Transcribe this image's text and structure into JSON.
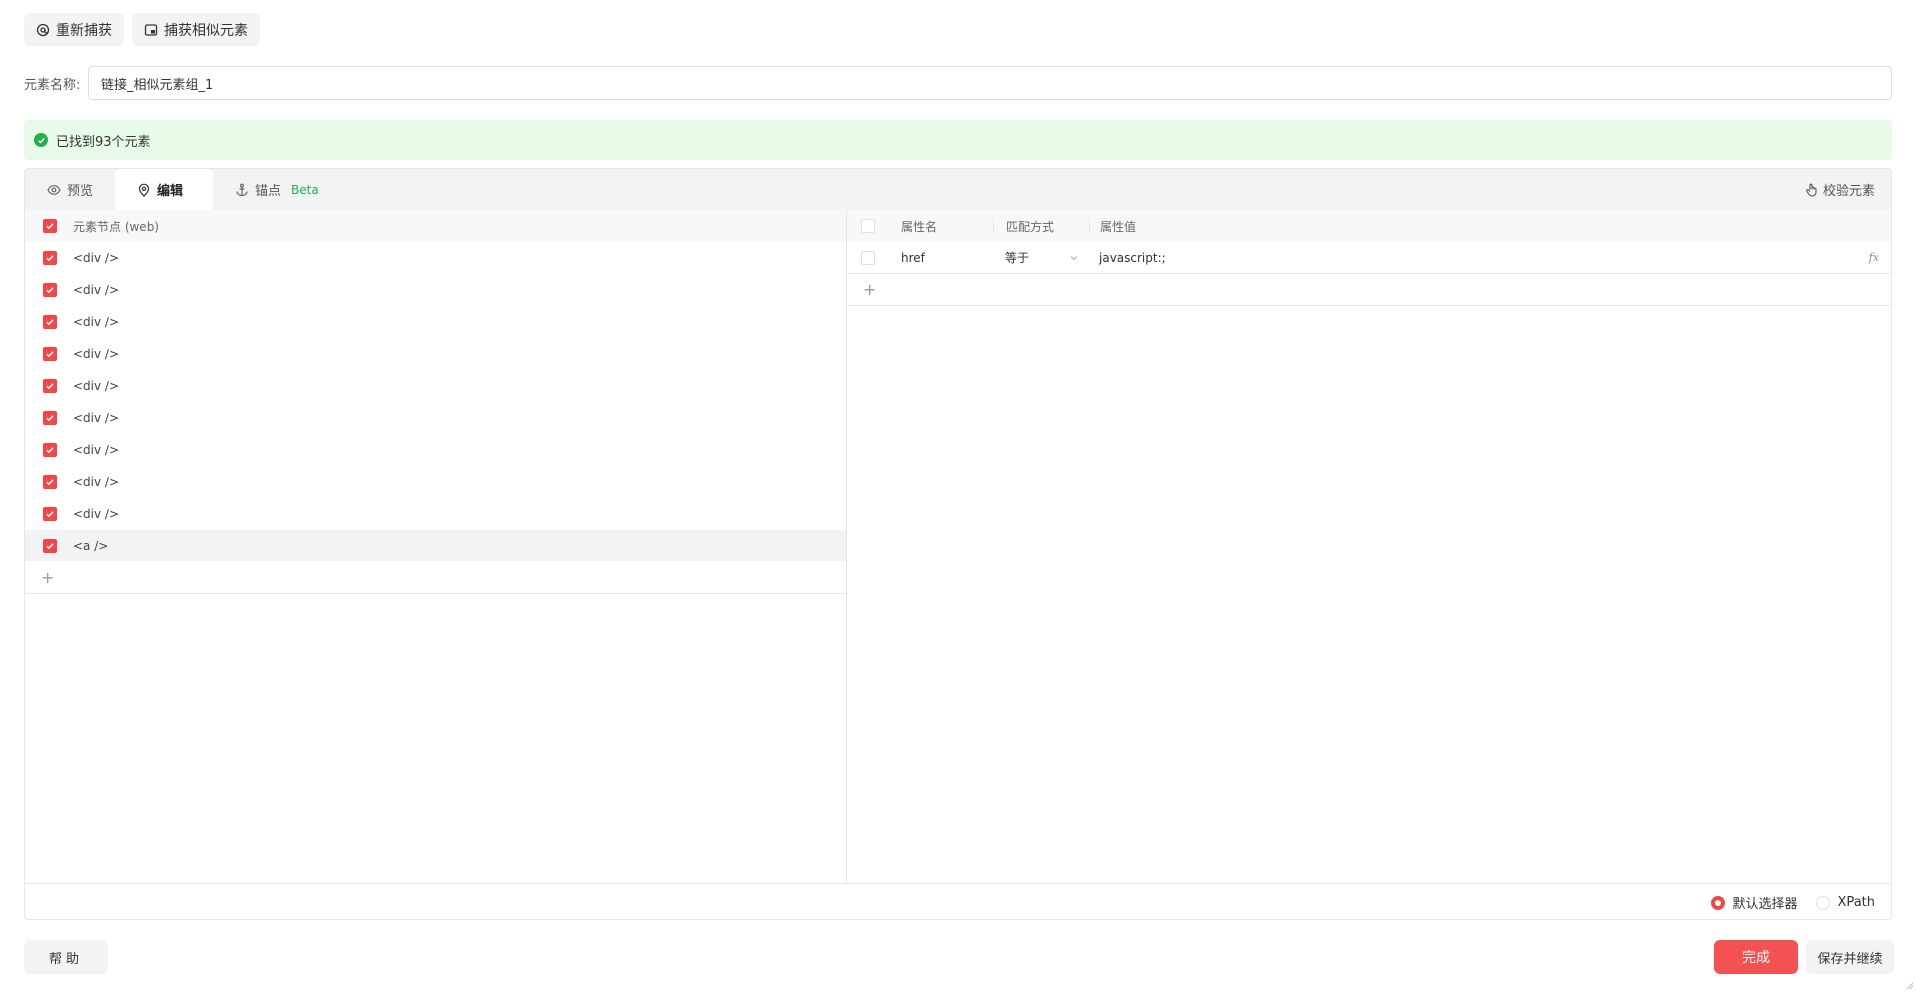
{
  "toolbar": {
    "recapture_label": "重新捕获",
    "capture_similar_label": "捕获相似元素"
  },
  "element_name": {
    "label": "元素名称:",
    "value": "链接_相似元素组_1"
  },
  "banner": {
    "text": "已找到93个元素"
  },
  "tabs": [
    {
      "label": "预览"
    },
    {
      "label": "编辑"
    },
    {
      "label": "锚点",
      "badge": "Beta"
    }
  ],
  "verify_label": "校验元素",
  "nodes": {
    "header": "元素节点 (web)",
    "items": [
      "<div />",
      "<div />",
      "<div />",
      "<div />",
      "<div />",
      "<div />",
      "<div />",
      "<div />",
      "<div />",
      "<a />"
    ],
    "add": "+"
  },
  "attributes": {
    "headers": {
      "name": "属性名",
      "match": "匹配方式",
      "value": "属性值"
    },
    "rows": [
      {
        "name": "href",
        "match": "等于",
        "value": "javascript:;",
        "fx": "fx"
      }
    ],
    "add": "+"
  },
  "selector": {
    "default_label": "默认选择器",
    "xpath_label": "XPath",
    "selected": "default"
  },
  "footer": {
    "help_label": "帮助",
    "done_label": "完成",
    "save_continue_label": "保存并继续"
  },
  "colors": {
    "accent": "#f45252",
    "success": "#22b04b",
    "banner_bg": "#e8fbe8"
  }
}
